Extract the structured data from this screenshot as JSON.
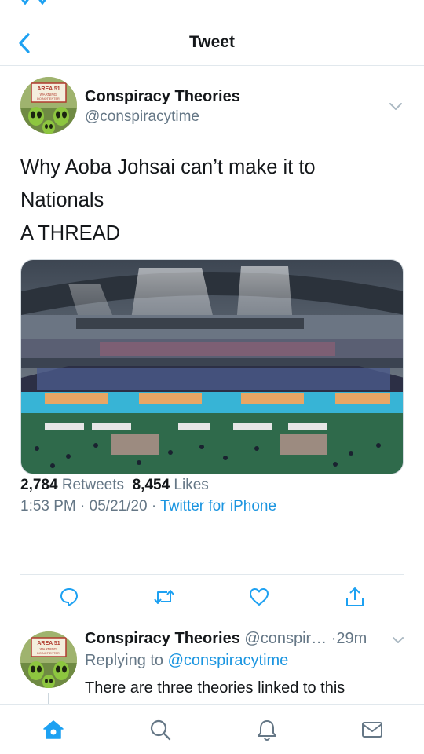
{
  "colors": {
    "accent": "#1da1f2",
    "link": "#1b95e0",
    "secondary_text": "#657786",
    "primary_text": "#14171a",
    "divider": "#e1e8ed"
  },
  "header": {
    "title": "Tweet",
    "back_icon": "chevron-left-icon"
  },
  "tweet": {
    "author": {
      "name": "Conspiracy Theories",
      "handle": "@conspiracytime",
      "avatar_sign_line1": "AREA 51",
      "avatar_sign_line2": "WARNING:",
      "avatar_sign_line3": "DO NOT ENTER!"
    },
    "text_lines": [
      "Why Aoba Johsai can’t make it to",
      "Nationals",
      "A THREAD"
    ],
    "media_description_icon": "image",
    "time": "1:53 PM",
    "date": "05/21/20",
    "source": "Twitter for iPhone",
    "separator": "·",
    "retweets_count": "2,784",
    "retweets_label": "Retweets",
    "likes_count": "8,454",
    "likes_label": "Likes",
    "actions": [
      "reply-icon",
      "retweet-icon",
      "like-icon",
      "share-icon"
    ]
  },
  "reply": {
    "author_name": "Conspiracy Theories",
    "author_handle": "@conspir…",
    "dot": "·",
    "age": "29m",
    "replying_label": "Replying to",
    "replying_handle": "@conspiracytime",
    "text": "There are three theories linked to this"
  },
  "tabbar": {
    "tabs": [
      "home-icon",
      "search-icon",
      "notifications-icon",
      "messages-icon"
    ],
    "active": "home-icon"
  }
}
